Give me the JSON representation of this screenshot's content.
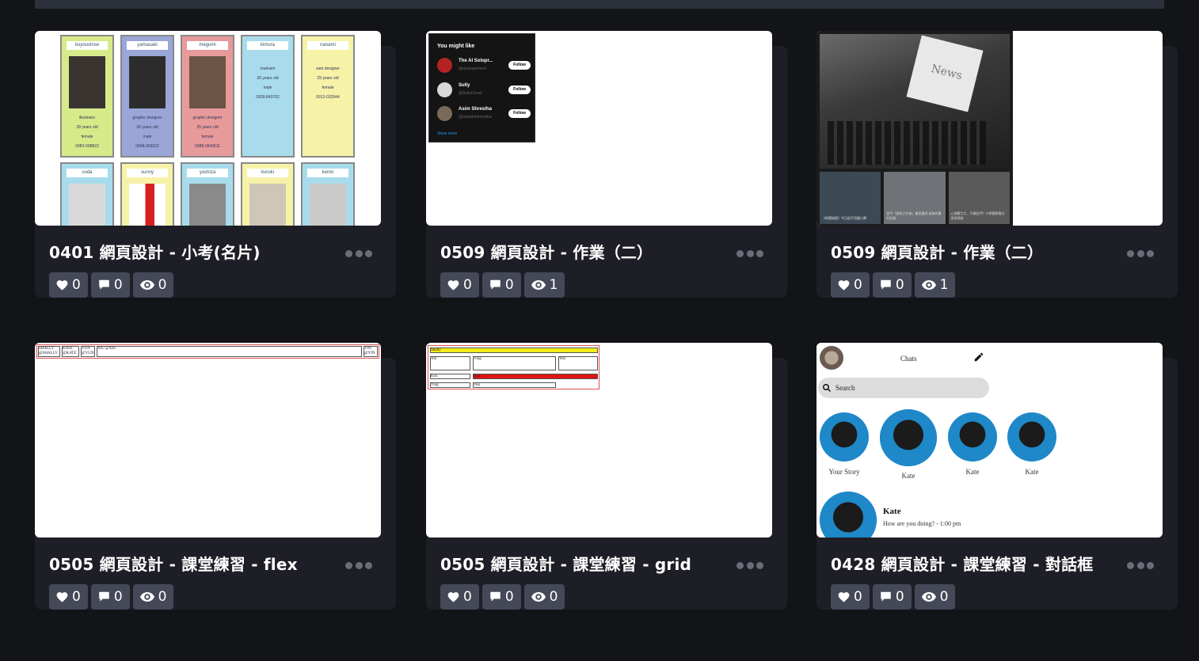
{
  "cards": [
    {
      "title": "0401 網頁設計 - 小考(名片)",
      "likes": "0",
      "comments": "0",
      "views": "0",
      "preview": {
        "people": [
          {
            "name": "koyoushow",
            "info": [
              "illustrator",
              "28 years old",
              "female",
              "0982-098822"
            ]
          },
          {
            "name": "yamasaki",
            "info": [
              "graphic designer",
              "30 years old",
              "male",
              "0948-063522"
            ]
          },
          {
            "name": "megumi",
            "info": [
              "graphic designer",
              "25 years old",
              "female",
              "0988-0943511"
            ]
          },
          {
            "name": "kimura",
            "info": [
              "marksim",
              "26 years old",
              "male",
              "0928-843762"
            ]
          },
          {
            "name": "nanami",
            "info": [
              "web designer",
              "29 years old",
              "female",
              "0912-032944"
            ]
          },
          {
            "name": "soda",
            "info": []
          },
          {
            "name": "sunny",
            "info": []
          },
          {
            "name": "yoshiza",
            "info": []
          },
          {
            "name": "kuroki",
            "info": []
          },
          {
            "name": "kento",
            "info": []
          }
        ]
      }
    },
    {
      "title": "0509 網頁設計 - 作業（二）",
      "likes": "0",
      "comments": "0",
      "views": "1",
      "preview": {
        "heading": "You might like",
        "follow": "Follow",
        "show_more": "Show more",
        "accounts": [
          {
            "name": "The AI Solopr...",
            "handle": "@aisolopreneur"
          },
          {
            "name": "Sully",
            "handle": "@SullyOmarr"
          },
          {
            "name": "Asim Shrestha",
            "handle": "@asimdotshrestha"
          }
        ]
      }
    },
    {
      "title": "0509 網頁設計 - 作業（二）",
      "likes": "0",
      "comments": "0",
      "views": "1",
      "preview": {
        "paper_text": "News",
        "captions": [
          "《新聞減肥》今日起不用戴口罩",
          "從今「調侃工作者」遇見鐵虎 成為的最好紀錄",
          "心理壓力大、不願出門？小時觀察看近思想導航"
        ]
      }
    },
    {
      "title": "0505 網頁設計 - 課堂練習 - flex",
      "likes": "0",
      "comments": "0",
      "views": "0",
      "preview": {
        "boxes": [
          "SHALLY @SHALLY",
          "KATE @KATE",
          "YUN @YUN",
          "XIU @XIU",
          "YIN @YIN"
        ]
      }
    },
    {
      "title": "0505 網頁設計 - 課堂練習 - grid",
      "likes": "0",
      "comments": "0",
      "views": "0",
      "preview": {
        "cells": [
          "Shally",
          "Xiu",
          "Ying",
          "Yun",
          "Kou",
          "Kou",
          "Ying",
          "Yun"
        ]
      }
    },
    {
      "title": "0428 網頁設計 - 課堂練習 - 對話框",
      "likes": "0",
      "comments": "0",
      "views": "0",
      "preview": {
        "header": "Chats",
        "search": "Search",
        "stories": [
          "Your Story",
          "Kate",
          "Kate",
          "Kate"
        ],
        "message_name": "Kate",
        "message_text": "How are you doing? - 1:00 pm"
      }
    }
  ]
}
